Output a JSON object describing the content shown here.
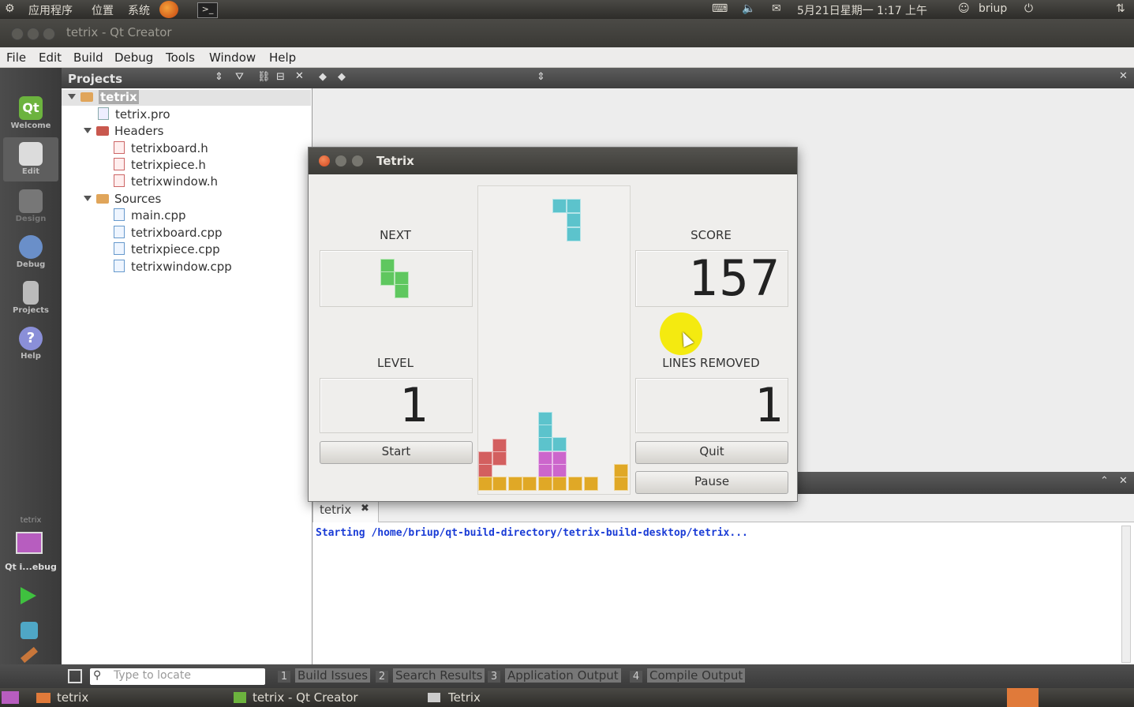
{
  "top_panel": {
    "apps": "应用程序",
    "places": "位置",
    "system": "系统",
    "datetime": "5月21日星期一  1:17 上午",
    "user": "briup"
  },
  "window": {
    "title": "tetrix - Qt Creator"
  },
  "menu": [
    "File",
    "Edit",
    "Build",
    "Debug",
    "Tools",
    "Window",
    "Help"
  ],
  "modes": [
    {
      "label": "Welcome",
      "color": "#6cb33e"
    },
    {
      "label": "Edit",
      "color": "#dcdcdc"
    },
    {
      "label": "Design",
      "color": "#777777"
    },
    {
      "label": "Debug",
      "color": "#6a8fc9"
    },
    {
      "label": "Projects",
      "color": "#bbbbbb"
    },
    {
      "label": "Help",
      "color": "#8a8fd8"
    }
  ],
  "target": {
    "project": "tetrix",
    "config": "Qt i...ebug"
  },
  "projects": {
    "title": "Projects",
    "root": "tetrix",
    "pro_file": "tetrix.pro",
    "headers_label": "Headers",
    "headers": [
      "tetrixboard.h",
      "tetrixpiece.h",
      "tetrixwindow.h"
    ],
    "sources_label": "Sources",
    "sources": [
      "main.cpp",
      "tetrixboard.cpp",
      "tetrixpiece.cpp",
      "tetrixwindow.cpp"
    ]
  },
  "output": {
    "tab": "tetrix",
    "line": "Starting /home/briup/qt-build-directory/tetrix-build-desktop/tetrix..."
  },
  "statusbar": {
    "locate_placeholder": "Type to locate",
    "tabs": [
      {
        "num": "1",
        "label": "Build Issues"
      },
      {
        "num": "2",
        "label": "Search Results"
      },
      {
        "num": "3",
        "label": "Application Output"
      },
      {
        "num": "4",
        "label": "Compile Output"
      }
    ]
  },
  "taskbar": [
    "tetrix",
    "tetrix - Qt Creator",
    "Tetrix"
  ],
  "tetrix": {
    "title": "Tetrix",
    "next_label": "NEXT",
    "level_label": "LEVEL",
    "score_label": "SCORE",
    "lines_label": "LINES REMOVED",
    "score": "157",
    "level": "1",
    "lines": "1",
    "start": "Start",
    "quit": "Quit",
    "pause": "Pause"
  }
}
